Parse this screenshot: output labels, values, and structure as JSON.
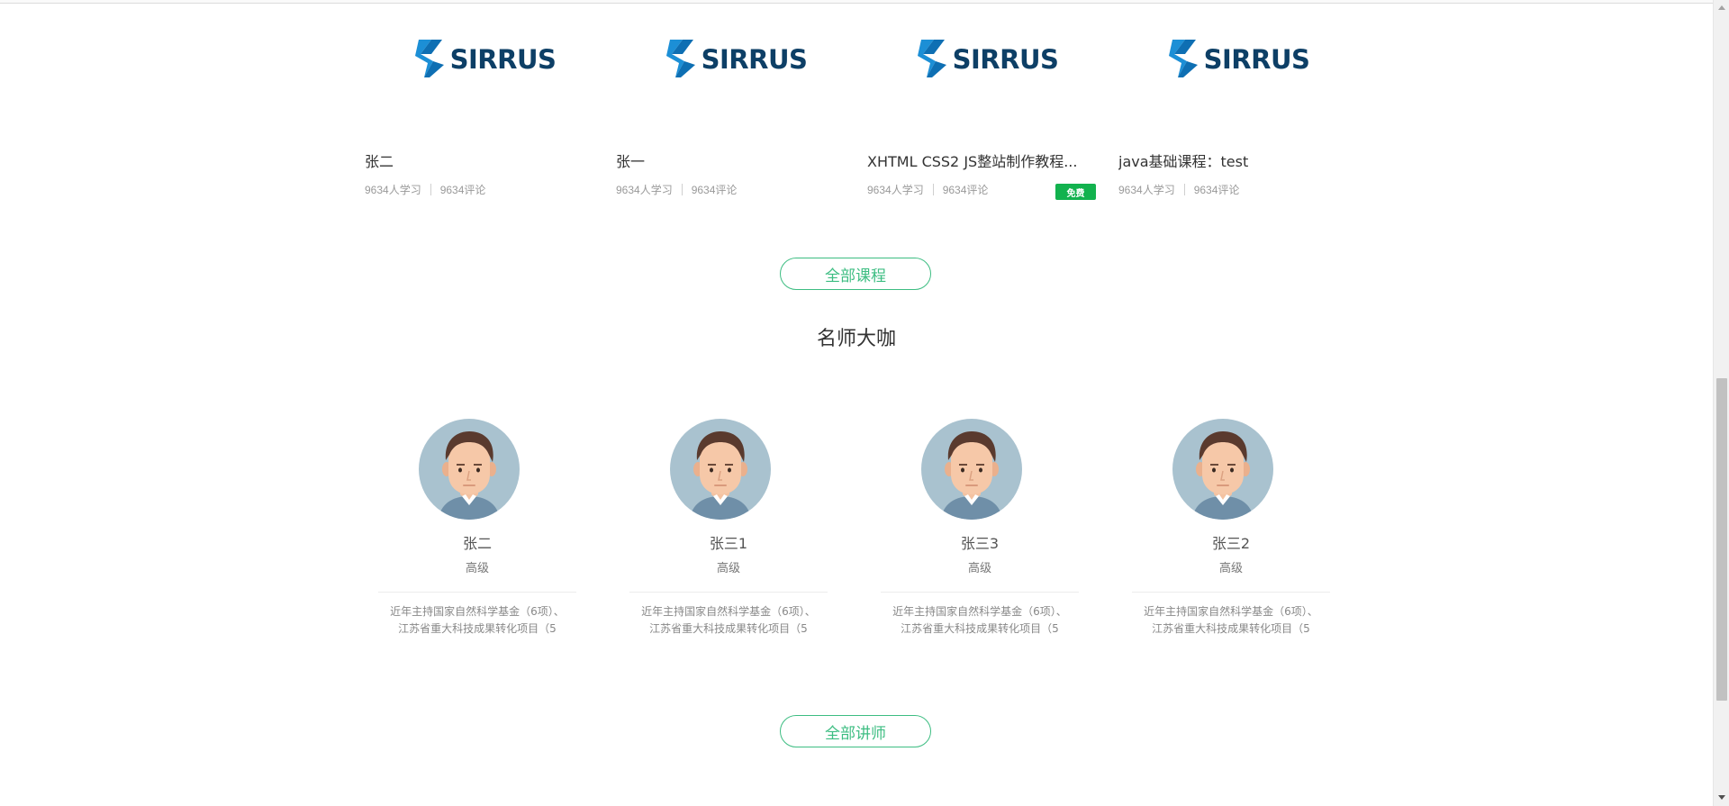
{
  "courses": [
    {
      "logo_text": "SIRRUS",
      "title": "张二",
      "learners": "9634人学习",
      "comments": "9634评论",
      "badge": ""
    },
    {
      "logo_text": "SIRRUS",
      "title": "张一",
      "learners": "9634人学习",
      "comments": "9634评论",
      "badge": ""
    },
    {
      "logo_text": "SIRRUS",
      "title": "XHTML CSS2 JS整站制作教程...",
      "learners": "9634人学习",
      "comments": "9634评论",
      "badge": "免费"
    },
    {
      "logo_text": "SIRRUS",
      "title": "java基础课程：test",
      "learners": "9634人学习",
      "comments": "9634评论",
      "badge": ""
    }
  ],
  "all_courses_button": "全部课程",
  "teachers_section_title": "名师大咖",
  "teachers": [
    {
      "name": "张二",
      "level": "高级",
      "desc_line1": "近年主持国家自然科学基金（6项）、",
      "desc_line2": "江苏省重大科技成果转化项目（5"
    },
    {
      "name": "张三1",
      "level": "高级",
      "desc_line1": "近年主持国家自然科学基金（6项）、",
      "desc_line2": "江苏省重大科技成果转化项目（5"
    },
    {
      "name": "张三3",
      "level": "高级",
      "desc_line1": "近年主持国家自然科学基金（6项）、",
      "desc_line2": "江苏省重大科技成果转化项目（5"
    },
    {
      "name": "张三2",
      "level": "高级",
      "desc_line1": "近年主持国家自然科学基金（6项）、",
      "desc_line2": "江苏省重大科技成果转化项目（5"
    }
  ],
  "all_teachers_button": "全部讲师",
  "colors": {
    "accent": "#3dbd82",
    "badge": "#12b24e",
    "logo_text": "#0d3f66",
    "logo_mark": "#1c8fd6"
  }
}
